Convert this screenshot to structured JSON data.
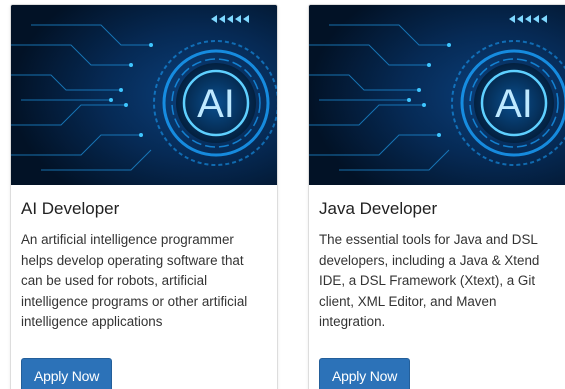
{
  "cards": [
    {
      "title": "AI Developer",
      "description": "An artificial intelligence programmer helps develop operating software that can be used for robots, artificial intelligence programs or other artificial intelligence applications",
      "button_label": "Apply Now",
      "image_text": "AI"
    },
    {
      "title": "Java Developer",
      "description": "The essential tools for Java and DSL developers, including a Java & Xtend IDE, a DSL Framework (Xtext), a Git client, XML Editor, and Maven integration.",
      "button_label": "Apply Now",
      "image_text": "AI"
    }
  ],
  "colors": {
    "button": "#2c72b8",
    "image_bg": "#041833",
    "glow": "#3fc6ff"
  }
}
